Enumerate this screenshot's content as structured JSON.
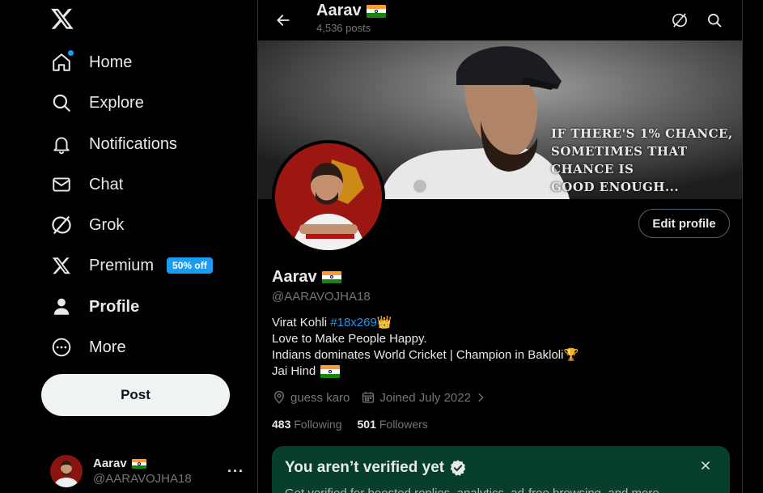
{
  "sidebar": {
    "items": [
      {
        "label": "Home",
        "icon": "home-icon"
      },
      {
        "label": "Explore",
        "icon": "search-icon"
      },
      {
        "label": "Notifications",
        "icon": "bell-icon"
      },
      {
        "label": "Chat",
        "icon": "mail-icon"
      },
      {
        "label": "Grok",
        "icon": "grok-icon"
      },
      {
        "label": "Premium",
        "icon": "x-logo-icon",
        "badge": "50% off"
      },
      {
        "label": "Profile",
        "icon": "person-icon"
      },
      {
        "label": "More",
        "icon": "more-circle-icon"
      }
    ],
    "post_label": "Post",
    "account": {
      "name": "Aarav",
      "handle": "@AARAVOJHA18",
      "more": "···"
    }
  },
  "header": {
    "title": "Aarav",
    "subtitle": "4,536 posts"
  },
  "banner": {
    "quote_lines": [
      "IF THERE'S 1% CHANCE,",
      "SOMETIMES THAT",
      "CHANCE IS",
      "GOOD ENOUGH..."
    ]
  },
  "profile": {
    "edit_label": "Edit profile",
    "name": "Aarav",
    "handle": "@AARAVOJHA18",
    "bio": {
      "line1_prefix": "Virat Kohli ",
      "line1_tag": "#18x269",
      "line1_emoji": "👑",
      "line2": "Love to Make People Happy.",
      "line3": "Indians dominates World Cricket | Champion in Bakloli",
      "line3_emoji": "🏆",
      "line4": "Jai Hind"
    },
    "location": "guess karo",
    "joined": "Joined July 2022",
    "following_count": "483",
    "following_label": "Following",
    "followers_count": "501",
    "followers_label": "Followers"
  },
  "verify_card": {
    "title": "You aren’t verified yet",
    "body": "Get verified for boosted replies, analytics, ad-free browsing, and more."
  },
  "colors": {
    "accent": "#1d9bf0",
    "background": "#000000",
    "card": "#073f2a",
    "muted": "#71767b"
  }
}
